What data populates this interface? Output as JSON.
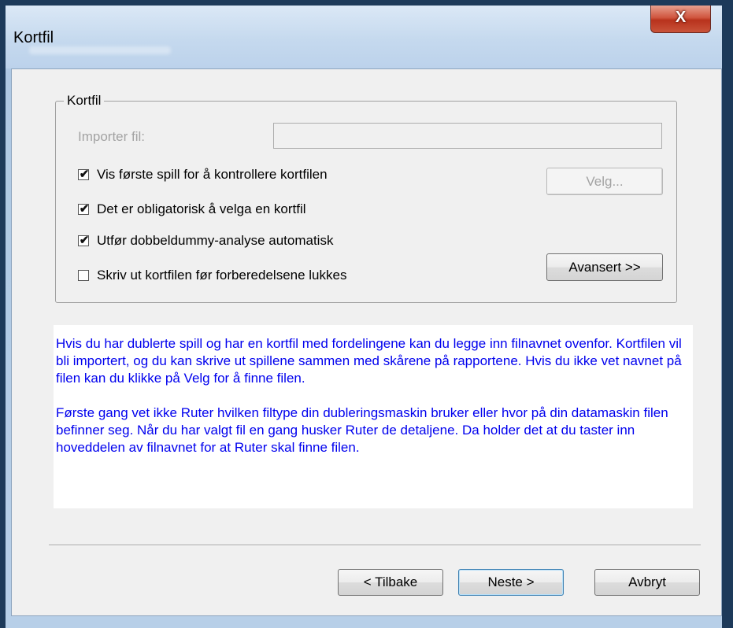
{
  "window": {
    "title": "Kortfil",
    "close_glyph": "X"
  },
  "group": {
    "legend": "Kortfil",
    "import_label": "Importer fil:",
    "import_value": "",
    "checkboxes": [
      {
        "label": "Vis første spill for å kontrollere kortfilen",
        "checked": true
      },
      {
        "label": "Det er obligatorisk å velga en kortfil",
        "checked": true
      },
      {
        "label": "Utfør dobbeldummy-analyse automatisk",
        "checked": true
      },
      {
        "label": "Skriv ut kortfilen før forberedelsene lukkes",
        "checked": false
      }
    ],
    "velg_label": "Velg...",
    "avansert_label": "Avansert >>"
  },
  "info": {
    "paragraph1": "Hvis du har dublerte spill og har en kortfil med fordelingene kan du legge inn filnavnet ovenfor. Kortfilen vil bli importert, og du kan skrive ut spillene sammen med skårene på rapportene. Hvis du ikke vet navnet på filen kan du klikke på Velg for å finne filen.",
    "paragraph2": "Første gang vet ikke Ruter hvilken filtype din dubleringsmaskin bruker eller hvor på din datamaskin filen befinner seg. Når du  har valgt fil en gang husker Ruter de detaljene. Da holder det at du taster inn hoveddelen av filnavnet for at Ruter skal finne filen."
  },
  "footer": {
    "back_label": "< Tilbake",
    "next_label": "Neste >",
    "cancel_label": "Avbryt"
  },
  "colors": {
    "info_text": "#0000ee",
    "close_button": "#c9533a"
  },
  "icons": {
    "checkmark": "check-icon",
    "close": "close-icon"
  }
}
